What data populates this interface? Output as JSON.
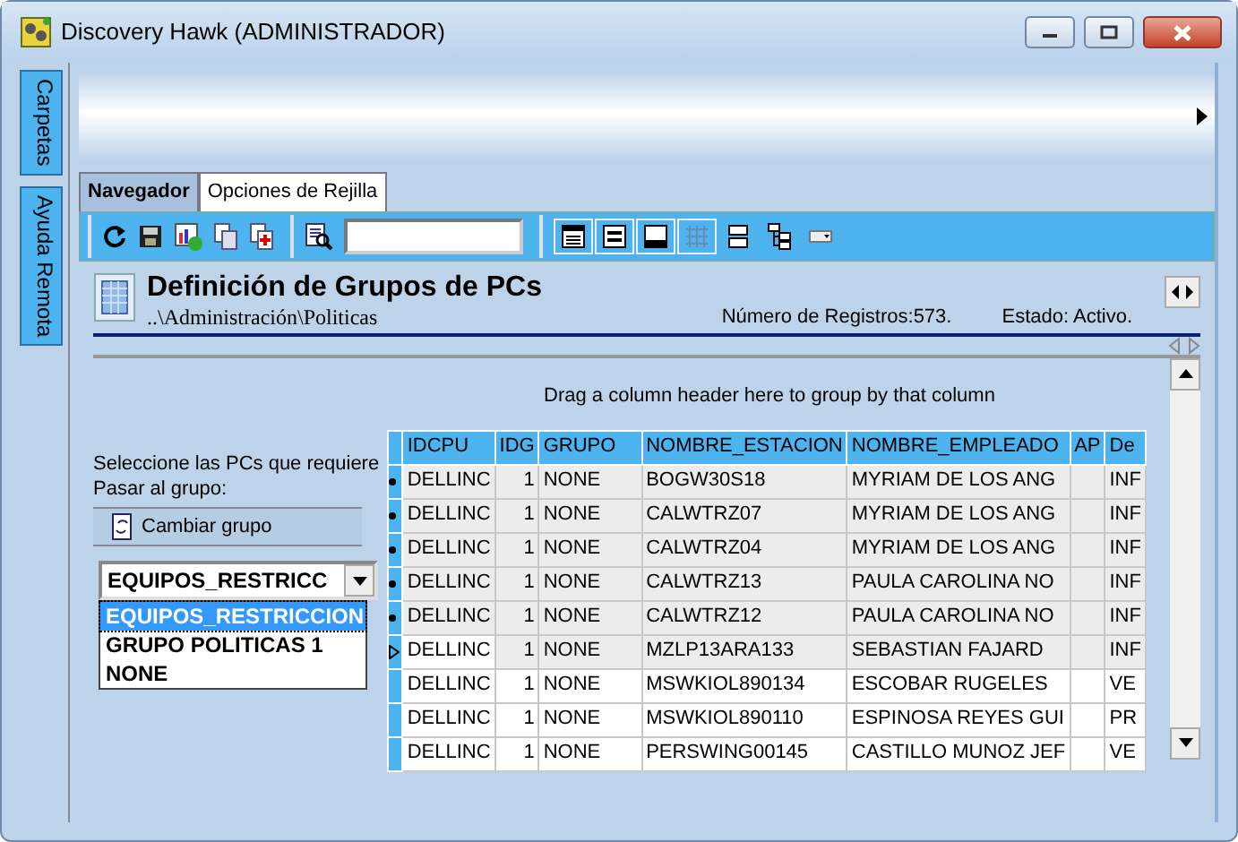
{
  "window": {
    "title": "Discovery Hawk (ADMINISTRADOR)"
  },
  "side_tabs": [
    {
      "label": "Carpetas",
      "selected": false
    },
    {
      "label": "Ayuda Remota",
      "selected": false
    }
  ],
  "tabs": [
    {
      "label": "Navegador",
      "selected": false
    },
    {
      "label": "Opciones de Rejilla",
      "selected": true
    }
  ],
  "header": {
    "title": "Definición de Grupos de PCs",
    "path": "..\\Administración\\Politicas",
    "records": "Número de Registros:573.",
    "status": "Estado: Activo."
  },
  "group_hint": "Drag a column header here to group by that column",
  "left_panel": {
    "instruction": "Seleccione las PCs que requiere",
    "group_label": "Pasar al grupo:",
    "button": "Cambiar grupo",
    "combo_value": "EQUIPOS_RESTRICC",
    "options": [
      {
        "label": "EQUIPOS_RESTRICCION",
        "selected": true
      },
      {
        "label": "GRUPO POLITICAS 1",
        "selected": false
      },
      {
        "label": "NONE",
        "selected": false
      }
    ]
  },
  "table": {
    "columns": [
      "IDCPU",
      "IDG",
      "GRUPO",
      "NOMBRE_ESTACION",
      "NOMBRE_EMPLEADO",
      "AP",
      "De"
    ],
    "rows": [
      {
        "selected": true,
        "current": false,
        "cells": [
          "DELLINC",
          "1",
          "NONE",
          "BOGW30S18",
          "MYRIAM DE LOS ANG",
          "",
          "INF"
        ]
      },
      {
        "selected": true,
        "current": false,
        "cells": [
          "DELLINC",
          "1",
          "NONE",
          "CALWTRZ07",
          "MYRIAM DE LOS ANG",
          "",
          "INF"
        ]
      },
      {
        "selected": true,
        "current": false,
        "cells": [
          "DELLINC",
          "1",
          "NONE",
          "CALWTRZ04",
          "MYRIAM DE LOS ANG",
          "",
          "INF"
        ]
      },
      {
        "selected": true,
        "current": false,
        "cells": [
          "DELLINC",
          "1",
          "NONE",
          "CALWTRZ13",
          "PAULA CAROLINA NO",
          "",
          "INF"
        ]
      },
      {
        "selected": true,
        "current": false,
        "cells": [
          "DELLINC",
          "1",
          "NONE",
          "CALWTRZ12",
          "PAULA CAROLINA NO",
          "",
          "INF"
        ]
      },
      {
        "selected": true,
        "current": true,
        "cells": [
          "DELLINC",
          "1",
          "NONE",
          "MZLP13ARA133",
          "SEBASTIAN FAJARD",
          "",
          "INF"
        ]
      },
      {
        "selected": false,
        "current": false,
        "cells": [
          "DELLINC",
          "1",
          "NONE",
          "MSWKIOL890134",
          "ESCOBAR RUGELES",
          "",
          "VE"
        ]
      },
      {
        "selected": false,
        "current": false,
        "cells": [
          "DELLINC",
          "1",
          "NONE",
          "MSWKIOL890110",
          "ESPINOSA REYES GUI",
          "",
          "PR"
        ]
      },
      {
        "selected": false,
        "current": false,
        "cells": [
          "DELLINC",
          "1",
          "NONE",
          "PERSWING00145",
          "CASTILLO MUNOZ JEF",
          "",
          "VE"
        ]
      }
    ]
  }
}
